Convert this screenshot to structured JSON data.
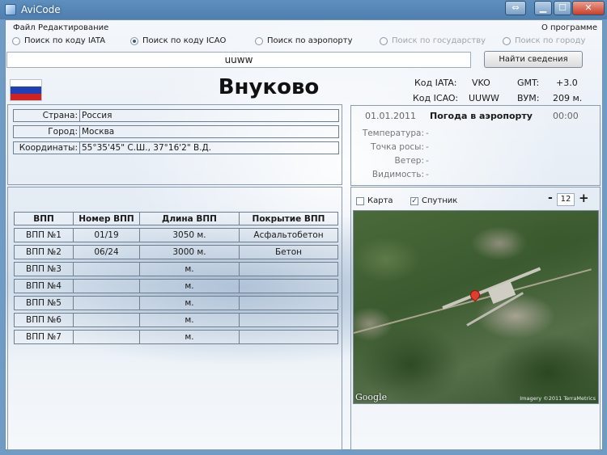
{
  "window": {
    "title": "AviCode",
    "restore_glyph": "⇔",
    "min_glyph": "▁",
    "max_glyph": "☐",
    "close_glyph": "✕"
  },
  "menu": {
    "file": "Файл",
    "edit": "Редактирование",
    "about": "О программе"
  },
  "search_modes": [
    {
      "label": "Поиск по коду IATA",
      "checked": false,
      "enabled": true
    },
    {
      "label": "Поиск по коду ICAO",
      "checked": true,
      "enabled": true
    },
    {
      "label": "Поиск по аэропорту",
      "checked": false,
      "enabled": true
    },
    {
      "label": "Поиск по государству",
      "checked": false,
      "enabled": false
    },
    {
      "label": "Поиск по городу",
      "checked": false,
      "enabled": false
    }
  ],
  "search": {
    "value": "uuww",
    "button": "Найти сведения"
  },
  "airport": {
    "name": "Внуково",
    "iata_label": "Код IATA:",
    "iata": "VKO",
    "gmt_label": "GMT:",
    "gmt": "+3.0",
    "icao_label": "Код ICAO:",
    "icao": "UUWW",
    "vum_label": "ВУМ:",
    "vum": "209 м."
  },
  "details": {
    "country_label": "Страна:",
    "country": "Россия",
    "city_label": "Город:",
    "city": "Москва",
    "coords_label": "Координаты:",
    "coords": "55°35'45\" С.Ш., 37°16'2\" В.Д."
  },
  "weather": {
    "date": "01.01.2011",
    "title": "Погода в аэропорту",
    "time": "00:00",
    "temperature_label": "Температура:",
    "temperature": "-",
    "dewpoint_label": "Точка росы:",
    "dewpoint": "-",
    "wind_label": "Ветер:",
    "wind": "-",
    "visibility_label": "Видимость:",
    "visibility": "-"
  },
  "runways": {
    "headers": [
      "ВПП",
      "Номер ВПП",
      "Длина ВПП",
      "Покрытие  ВПП"
    ],
    "rows": [
      {
        "name": "ВПП №1",
        "number": "01/19",
        "length": "3050 м.",
        "surface": "Асфальтобетон"
      },
      {
        "name": "ВПП №2",
        "number": "06/24",
        "length": "3000 м.",
        "surface": "Бетон"
      },
      {
        "name": "ВПП №3",
        "number": "",
        "length": "м.",
        "surface": ""
      },
      {
        "name": "ВПП №4",
        "number": "",
        "length": "м.",
        "surface": ""
      },
      {
        "name": "ВПП №5",
        "number": "",
        "length": "м.",
        "surface": ""
      },
      {
        "name": "ВПП №6",
        "number": "",
        "length": "м.",
        "surface": ""
      },
      {
        "name": "ВПП №7",
        "number": "",
        "length": "м.",
        "surface": ""
      }
    ]
  },
  "map": {
    "map_label": "Карта",
    "map_checked": false,
    "satellite_label": "Спутник",
    "satellite_checked": true,
    "zoom": "12",
    "zoom_minus": "-",
    "zoom_plus": "+",
    "logo": "Google",
    "copyright": "Imagery ©2011 TerraMetrics"
  }
}
